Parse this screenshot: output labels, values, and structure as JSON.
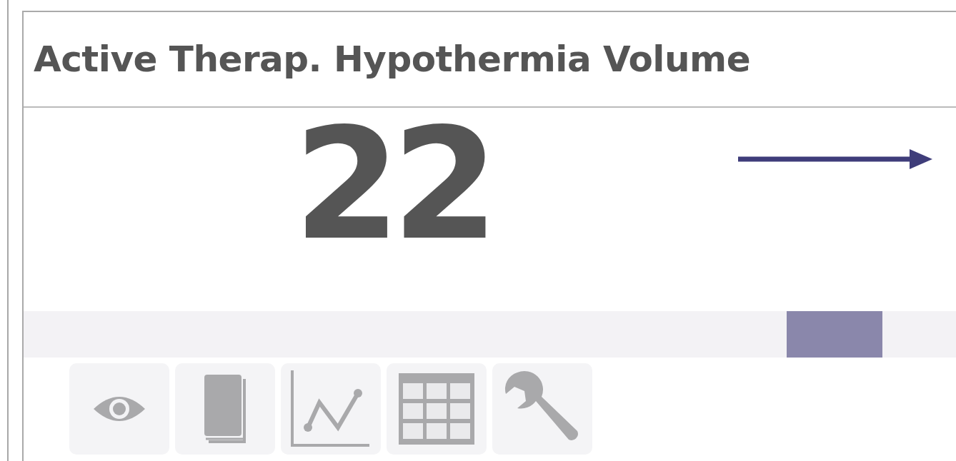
{
  "tile": {
    "title": "Active Therap. Hypothermia Volume",
    "value": "22",
    "trend": {
      "kind": "flat"
    },
    "range": {
      "level": 0.87
    }
  },
  "actions": [
    {
      "kind": "view"
    },
    {
      "kind": "guide"
    },
    {
      "kind": "chart"
    },
    {
      "kind": "table"
    },
    {
      "kind": "settings"
    }
  ]
}
